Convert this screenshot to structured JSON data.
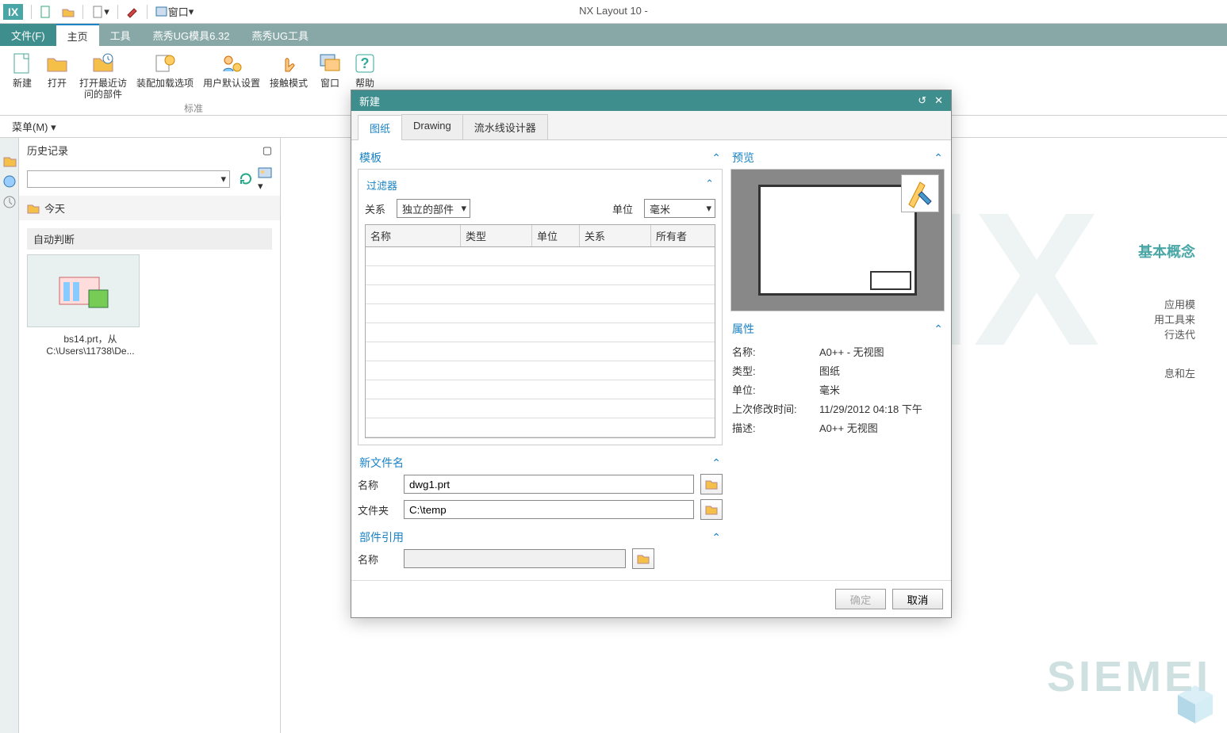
{
  "app_title": "NX Layout 10 -",
  "quick": {
    "window": "窗口"
  },
  "tabs": {
    "file": "文件(F)",
    "home": "主页",
    "tools": "工具",
    "yx1": "燕秀UG模具6.32",
    "yx2": "燕秀UG工具"
  },
  "ribbon": {
    "new": "新建",
    "open": "打开",
    "recent": "打开最近访\n问的部件",
    "load": "装配加载选项",
    "userdef": "用户默认设置",
    "touch": "接触模式",
    "window": "窗口",
    "help": "帮助",
    "group_label": "标准"
  },
  "menu_row": {
    "menu": "菜单(M)"
  },
  "history": {
    "title": "历史记录",
    "today": "今天",
    "auto": "自动判断",
    "file_cap1": "bs14.prt，从",
    "file_cap2": "C:\\Users\\11738\\De..."
  },
  "canvas": {
    "concept": "基本概念",
    "side1": "应用模",
    "side2": "用工具来",
    "side3": "行迭代",
    "side4": "息和左"
  },
  "dialog": {
    "title": "新建",
    "tabs": {
      "sheet": "图纸",
      "drawing": "Drawing",
      "flow": "流水线设计器"
    },
    "templates": "模板",
    "filter": "过滤器",
    "relation": "关系",
    "relation_val": "独立的部件",
    "unit": "单位",
    "unit_val": "毫米",
    "cols": {
      "name": "名称",
      "type": "类型",
      "unit": "单位",
      "relation": "关系",
      "owner": "所有者"
    },
    "preview": "预览",
    "props": "属性",
    "p_name_l": "名称:",
    "p_name_v": "A0++ - 无视图",
    "p_type_l": "类型:",
    "p_type_v": "图纸",
    "p_unit_l": "单位:",
    "p_unit_v": "毫米",
    "p_mod_l": "上次修改时间:",
    "p_mod_v": "11/29/2012 04:18 下午",
    "p_desc_l": "描述:",
    "p_desc_v": "A0++ 无视图",
    "newfile": "新文件名",
    "nf_name": "名称",
    "nf_name_v": "dwg1.prt",
    "nf_folder": "文件夹",
    "nf_folder_v": "C:\\temp",
    "partref": "部件引用",
    "pr_name": "名称",
    "ok": "确定",
    "cancel": "取消"
  }
}
